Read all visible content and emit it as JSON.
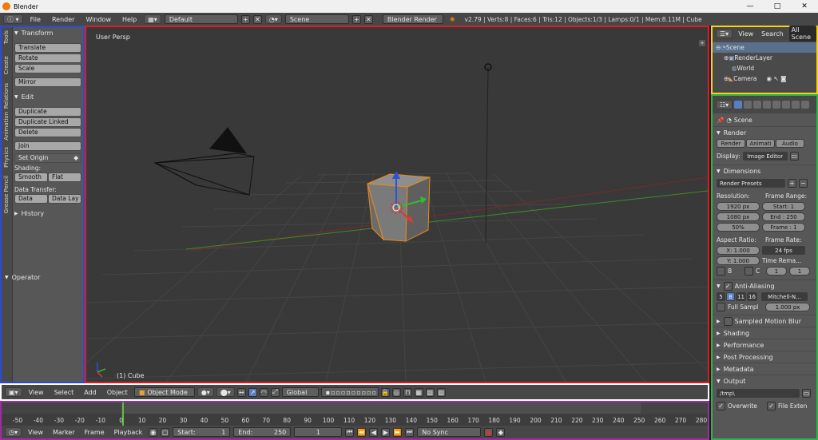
{
  "window": {
    "title": "Blender",
    "controls": {
      "minimize": "—",
      "maximize": "□",
      "close": "✕"
    }
  },
  "info_header": {
    "menus": [
      "File",
      "Render",
      "Window",
      "Help"
    ],
    "layout": "Default",
    "scene": "Scene",
    "engine": "Blender Render",
    "stats": "v2.79 | Verts:8 | Faces:6 | Tris:12 | Objects:1/3 | Lamps:0/1 | Mem:8.11M | Cube"
  },
  "tool_shelf": {
    "tabs": [
      "Tools",
      "Create",
      "Relations",
      "Animation",
      "Physics",
      "Grease Pencil"
    ],
    "transform": {
      "header": "Transform",
      "buttons": [
        "Translate",
        "Rotate",
        "Scale",
        "Mirror"
      ]
    },
    "edit": {
      "header": "Edit",
      "buttons": [
        "Duplicate",
        "Duplicate Linked",
        "Delete",
        "Join"
      ],
      "set_origin": "Set Origin",
      "shading_label": "Shading:",
      "smooth": "Smooth",
      "flat": "Flat",
      "data_transfer_label": "Data Transfer:",
      "data": "Data",
      "data_lay": "Data Lay"
    },
    "history": "History",
    "operator": "Operator"
  },
  "viewport": {
    "label": "User Persp",
    "object": "(1) Cube"
  },
  "outliner": {
    "view": "View",
    "search": "Search",
    "filter": "All Scene",
    "items": [
      "Scene",
      "RenderLayer",
      "World",
      "Camera"
    ]
  },
  "properties": {
    "scene": "Scene",
    "render": {
      "header": "Render",
      "render_btn": "Render",
      "animation_btn": "Animati",
      "audio_btn": "Audio",
      "display_label": "Display:",
      "display_value": "Image Editor"
    },
    "dimensions": {
      "header": "Dimensions",
      "presets": "Render Presets",
      "resolution_label": "Resolution:",
      "frame_range_label": "Frame Range:",
      "res_x": "1920 px",
      "res_y": "1080 px",
      "res_pct": "50%",
      "start": "Start: 1",
      "end": "End : 250",
      "frame": "Frame : 1",
      "aspect_label": "Aspect Ratio:",
      "frame_rate_label": "Frame Rate:",
      "aspect_x": "X:  1.000",
      "aspect_y": "Y:  1.000",
      "fps": "24 fps",
      "time_remap_label": "Time Rema...",
      "remap_old": "1",
      "remap_new": "1",
      "border": "B",
      "crop": "C"
    },
    "anti_aliasing": {
      "header": "Anti-Aliasing",
      "samples": [
        "5",
        "8",
        "11",
        "16"
      ],
      "filter": "Mitchell-N...",
      "full_sample": "Full Sampl",
      "size": "1.000 px"
    },
    "sections": [
      "Sampled Motion Blur",
      "Shading",
      "Performance",
      "Post Processing",
      "Metadata"
    ],
    "output": {
      "header": "Output",
      "path": "/tmp\\",
      "overwrite": "Overwrite",
      "file_ext": "File Exten"
    }
  },
  "viewport_header": {
    "menus": [
      "View",
      "Select",
      "Add",
      "Object"
    ],
    "mode": "Object Mode",
    "orientation": "Global"
  },
  "timeline": {
    "ticks": [
      "-50",
      "-40",
      "-30",
      "-20",
      "-10",
      "0",
      "10",
      "20",
      "30",
      "40",
      "50",
      "60",
      "70",
      "80",
      "90",
      "100",
      "110",
      "120",
      "130",
      "140",
      "150",
      "160",
      "170",
      "180",
      "190",
      "200",
      "210",
      "220",
      "230",
      "240",
      "250",
      "260",
      "270",
      "280"
    ],
    "menus": [
      "View",
      "Marker",
      "Frame",
      "Playback"
    ],
    "start": "Start:",
    "start_val": "1",
    "end": "End:",
    "end_val": "250",
    "current": "1",
    "sync": "No Sync"
  }
}
